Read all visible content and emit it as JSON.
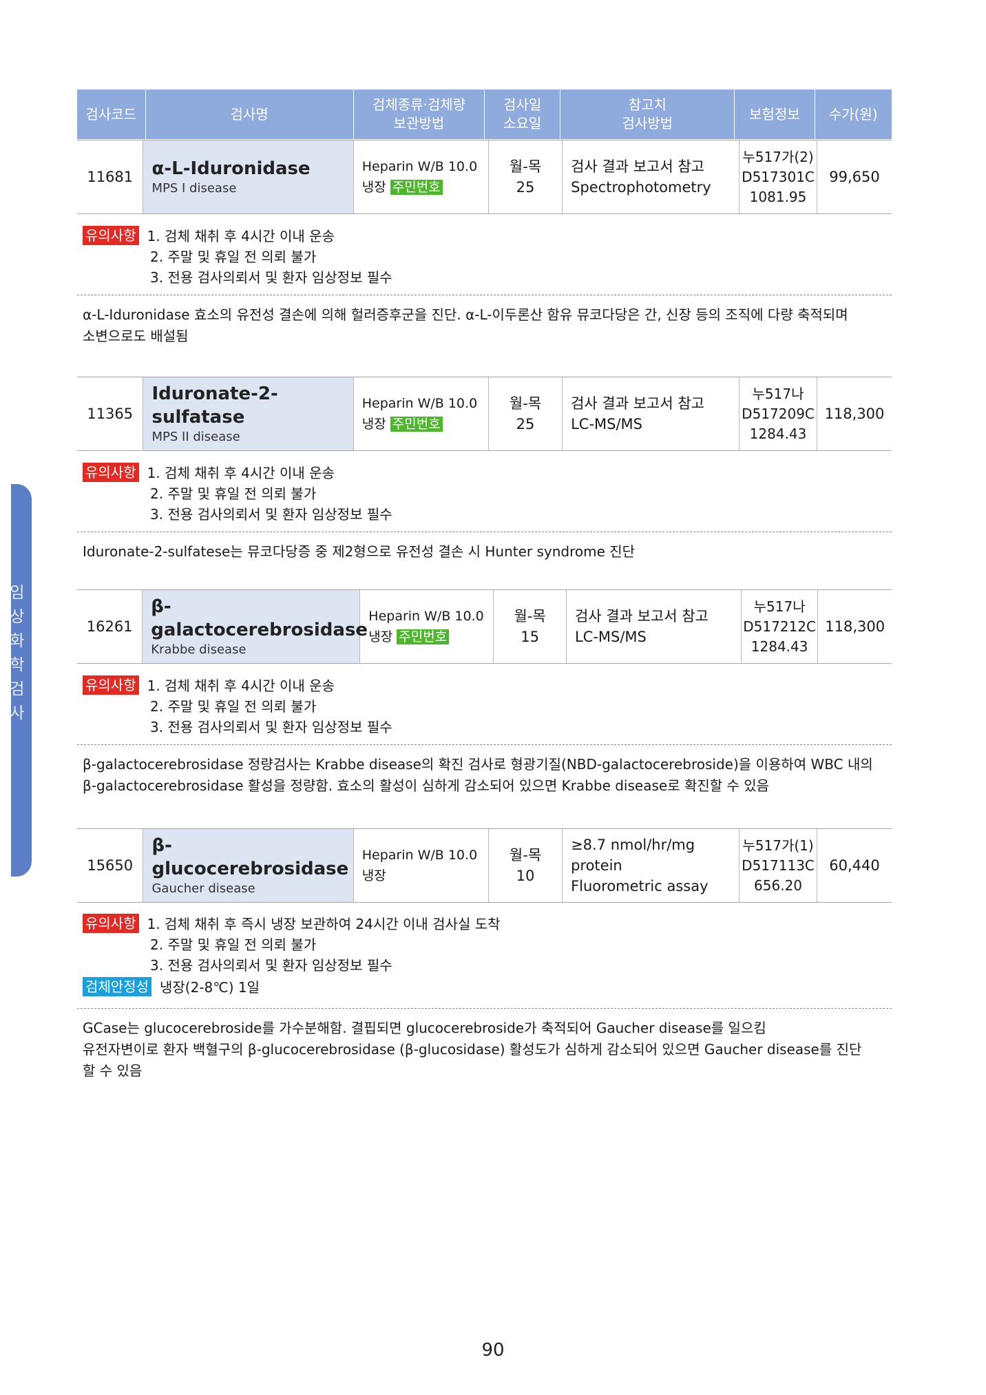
{
  "side_label": "임상화학검사",
  "header": {
    "code": "검사코드",
    "name": "검사명",
    "specimen": [
      "검체종류·검체량",
      "보관방법"
    ],
    "days": [
      "검사일",
      "소요일"
    ],
    "reference": [
      "참고치",
      "검사방법"
    ],
    "insurance": "보험정보",
    "price": "수가(원)"
  },
  "tests": [
    {
      "code": "11681",
      "name": "α-L-Iduronidase",
      "disease": "MPS I disease",
      "specimen": "Heparin W/B 10.0",
      "storage": "냉장",
      "tag": "주민번호",
      "days": "월-목",
      "tat": "25",
      "ref": "검사 결과 보고서 참고",
      "method": "Spectrophotometry",
      "ins": [
        "누517가(2)",
        "D517301C",
        "1081.95"
      ],
      "price": "99,650",
      "notes_label": "유의사항",
      "notes": [
        "1. 검체 채취 후 4시간 이내 운송",
        "2. 주말 및 휴일 전 의뢰 불가",
        "3. 전용 검사의뢰서 및 환자 임상정보 필수"
      ],
      "desc": [
        "α-L-Iduronidase 효소의 유전성 결손에 의해 헐러증후군을 진단. α-L-이두론산 함유 뮤코다당은 간, 신장 등의 조직에 다량 축적되며",
        "소변으로도 배설됨"
      ]
    },
    {
      "code": "11365",
      "name": "Iduronate-2-sulfatase",
      "disease": "MPS II  disease",
      "specimen": "Heparin W/B 10.0",
      "storage": "냉장",
      "tag": "주민번호",
      "days": "월-목",
      "tat": "25",
      "ref": "검사 결과 보고서 참고",
      "method": "LC-MS/MS",
      "ins": [
        "누517나",
        "D517209C",
        "1284.43"
      ],
      "price": "118,300",
      "notes_label": "유의사항",
      "notes": [
        "1. 검체 채취 후 4시간 이내 운송",
        "2. 주말 및 휴일 전 의뢰 불가",
        "3. 전용 검사의뢰서 및 환자 임상정보 필수"
      ],
      "desc": [
        "Iduronate-2-sulfatese는 뮤코다당증 중 제2형으로 유전성 결손 시 Hunter syndrome 진단"
      ]
    },
    {
      "code": "16261",
      "name": "β-galactocerebrosidase",
      "disease": "Krabbe disease",
      "specimen": "Heparin W/B 10.0",
      "storage": "냉장",
      "tag": "주민번호",
      "days": "월-목",
      "tat": "15",
      "ref": "검사 결과 보고서 참고",
      "method": "LC-MS/MS",
      "ins": [
        "누517나",
        "D517212C",
        "1284.43"
      ],
      "price": "118,300",
      "notes_label": "유의사항",
      "notes": [
        "1. 검체 채취 후 4시간 이내 운송",
        "2. 주말 및 휴일 전 의뢰 불가",
        "3. 전용 검사의뢰서 및 환자 임상정보 필수"
      ],
      "desc": [
        "β-galactocerebrosidase 정량검사는 Krabbe disease의 확진 검사로 형광기질(NBD-galactocerebroside)을 이용하여 WBC 내의",
        "β-galactocerebrosidase 활성을 정량함. 효소의 활성이 심하게 감소되어 있으면 Krabbe disease로 확진할 수 있음"
      ]
    },
    {
      "code": "15650",
      "name": "β-glucocerebrosidase",
      "disease": "Gaucher disease",
      "specimen": "Heparin W/B 10.0",
      "storage": "냉장",
      "tag": "",
      "days": "월-목",
      "tat": "10",
      "ref": "≥8.7 nmol/hr/mg protein",
      "method": "Fluorometric assay",
      "ins": [
        "누517가(1)",
        "D517113C",
        "656.20"
      ],
      "price": "60,440",
      "notes_label": "유의사항",
      "notes": [
        "1. 검체 채취 후 즉시 냉장 보관하여 24시간 이내 검사실 도착",
        "2. 주말 및 휴일 전 의뢰 불가",
        "3. 전용 검사의뢰서 및 환자 임상정보 필수"
      ],
      "stability_label": "검체안정성",
      "stability": "냉장(2-8℃) 1일",
      "desc": [
        "GCase는 glucocerebroside를 가수분해함. 결핍되면 glucocerebroside가 축적되어 Gaucher disease를 일으킴",
        "유전자변이로 환자 백혈구의 β-glucocerebrosidase (β-glucosidase) 활성도가 심하게 감소되어 있으면 Gaucher disease를 진단",
        "할 수 있음"
      ]
    }
  ],
  "page_number": "90",
  "colors": {
    "header_bg": "#8faadc",
    "name_cell_bg": "#dde5f3",
    "notes_tag": "#e42822",
    "stability_tag": "#1aa1dd",
    "id_tag": "#4db62d",
    "side_tab": "#5b7ec6"
  }
}
